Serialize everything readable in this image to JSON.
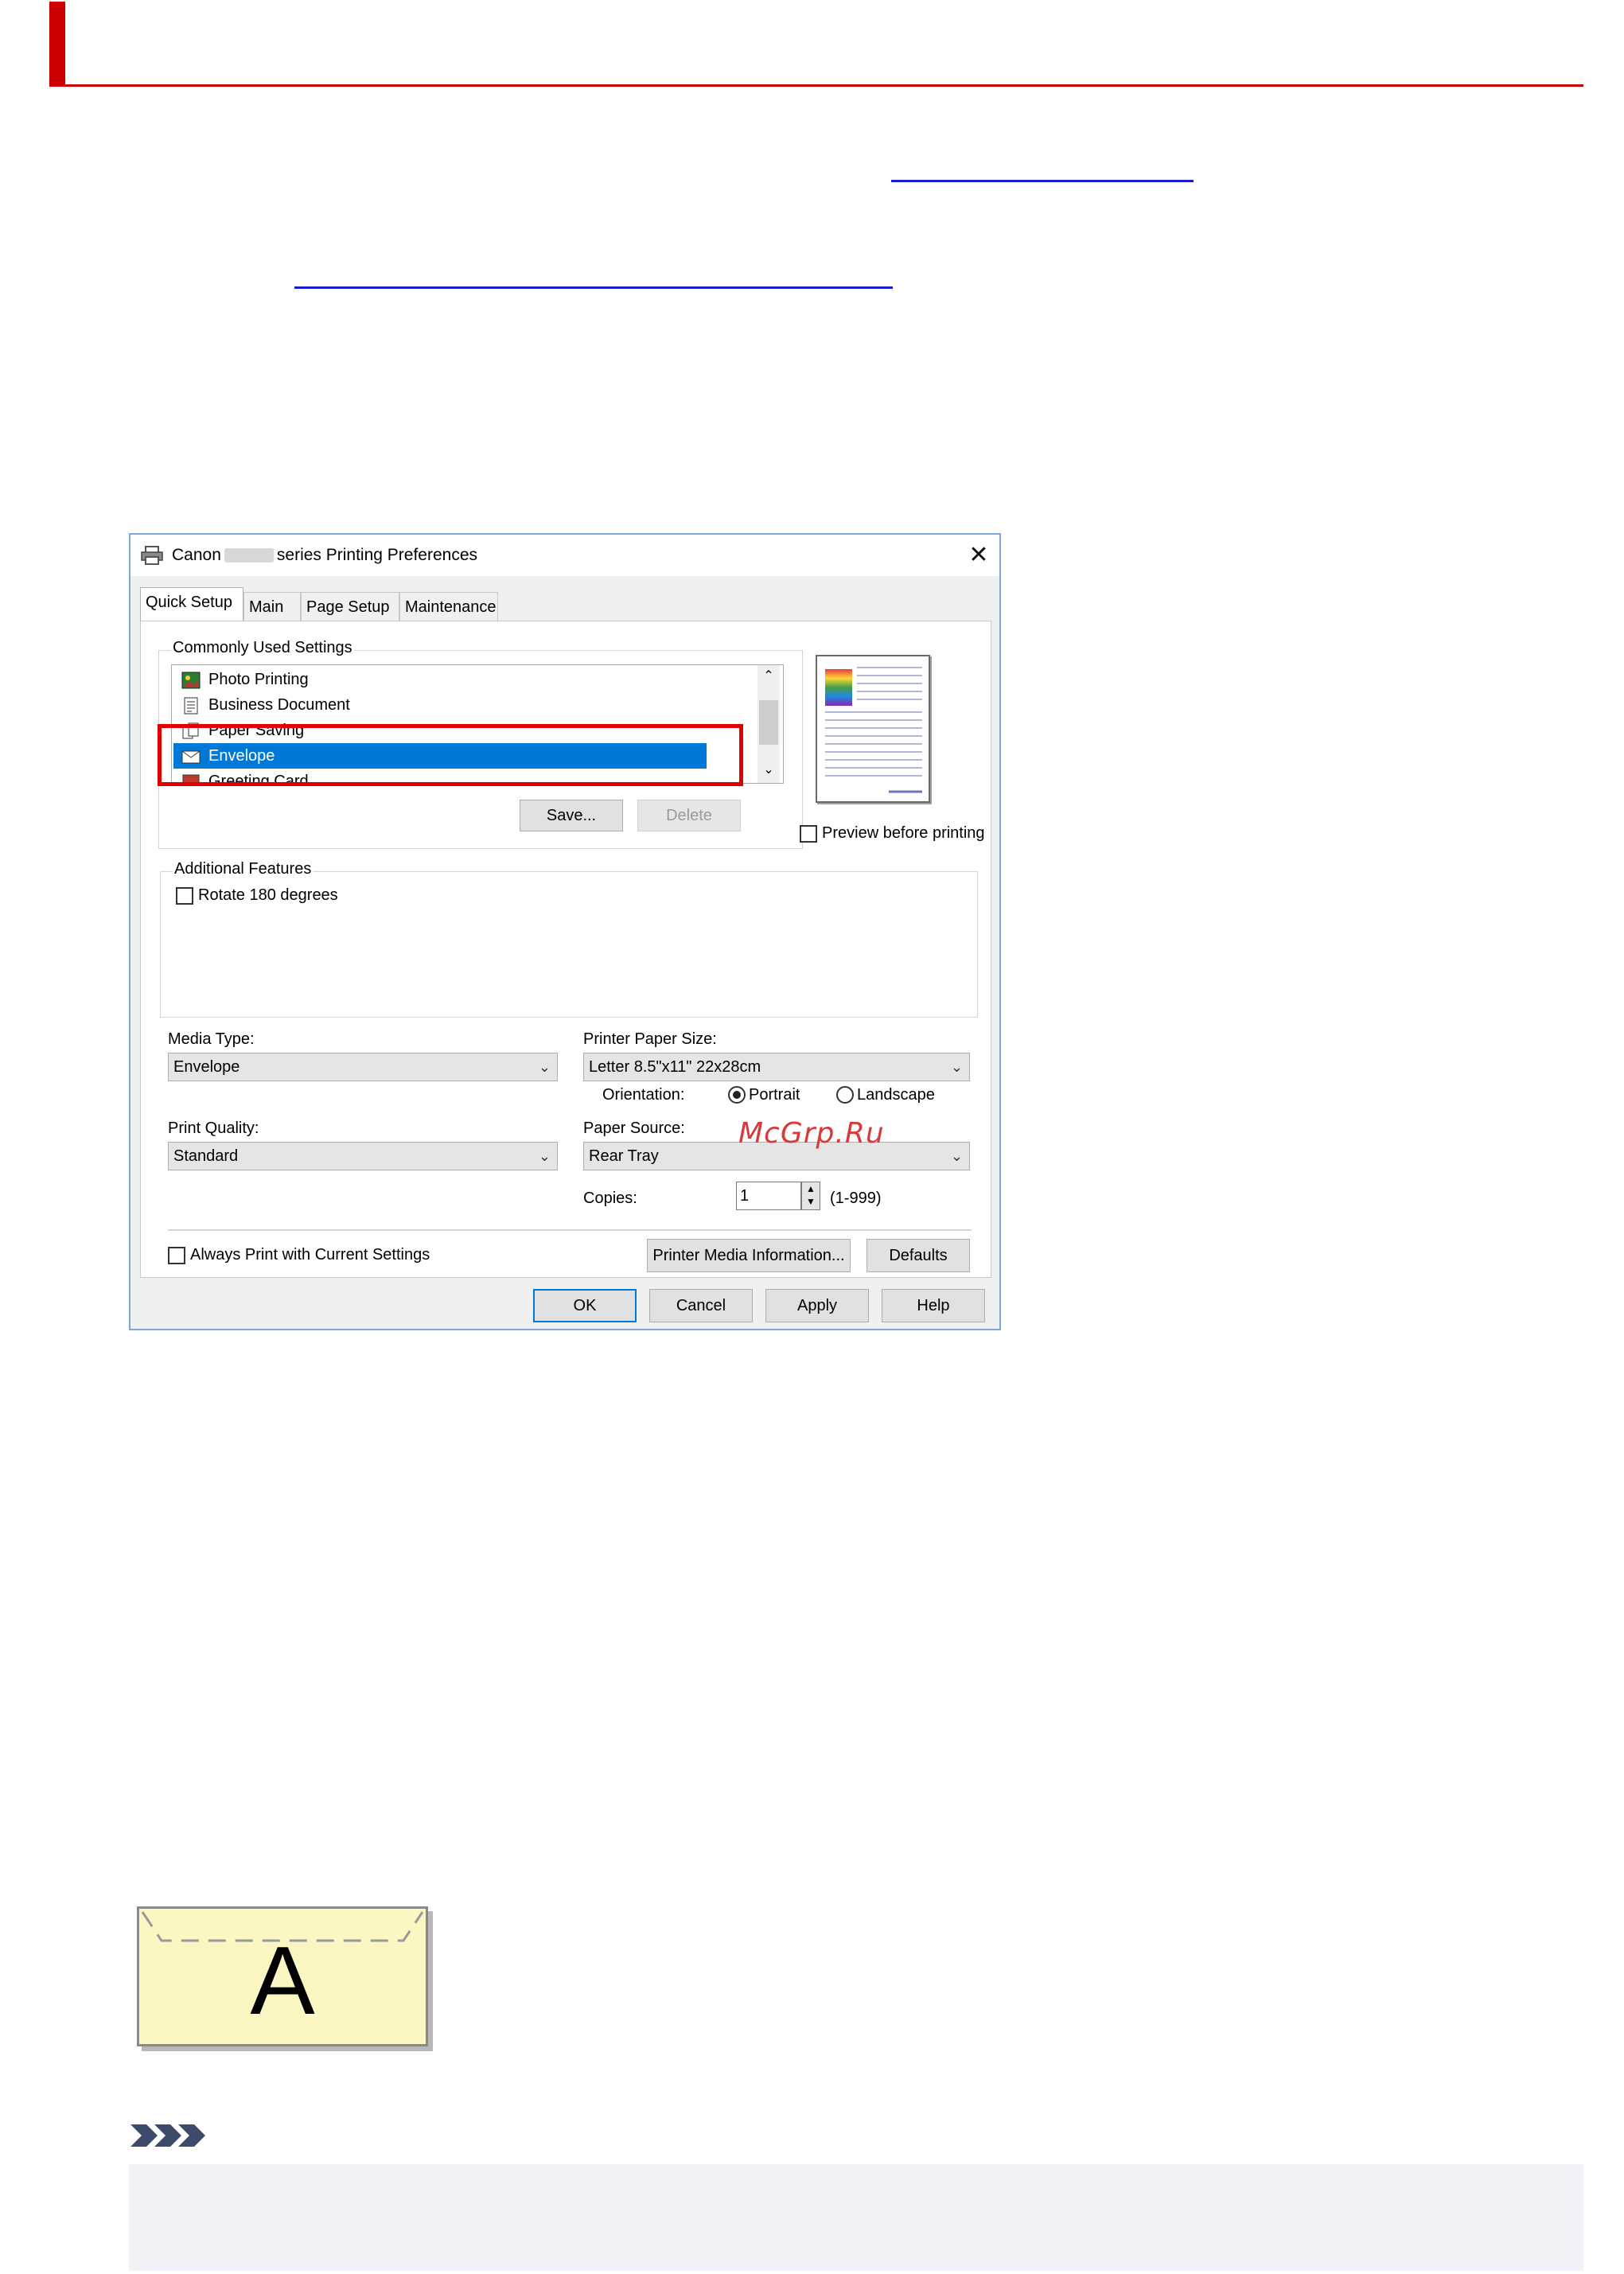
{
  "dialog": {
    "title_prefix": "Canon",
    "title_suffix": "series Printing Preferences",
    "close_glyph": "✕",
    "tabs": [
      {
        "label": "Quick Setup",
        "active": true
      },
      {
        "label": "Main",
        "active": false
      },
      {
        "label": "Page Setup",
        "active": false
      },
      {
        "label": "Maintenance",
        "active": false
      }
    ],
    "commonly_used": {
      "label": "Commonly Used Settings",
      "items": [
        {
          "label": "Photo Printing",
          "icon": "photo-icon"
        },
        {
          "label": "Business Document",
          "icon": "document-icon"
        },
        {
          "label": "Paper Saving",
          "icon": "paper-saving-icon"
        },
        {
          "label": "Envelope",
          "icon": "envelope-icon",
          "selected": true
        },
        {
          "label": "Greeting Card",
          "icon": "greeting-card-icon"
        }
      ],
      "save_label": "Save...",
      "delete_label": "Delete"
    },
    "preview_before_printing": {
      "label": "Preview before printing",
      "checked": false
    },
    "additional_features": {
      "label": "Additional Features",
      "rotate_180": {
        "label": "Rotate 180 degrees",
        "checked": false
      }
    },
    "media_type": {
      "label": "Media Type:",
      "value": "Envelope"
    },
    "print_quality": {
      "label": "Print Quality:",
      "value": "Standard"
    },
    "printer_paper_size": {
      "label": "Printer Paper Size:",
      "value": "Letter 8.5\"x11\" 22x28cm"
    },
    "orientation": {
      "label": "Orientation:",
      "portrait": "Portrait",
      "landscape": "Landscape",
      "selected": "Portrait"
    },
    "paper_source": {
      "label": "Paper Source:",
      "value": "Rear Tray"
    },
    "copies": {
      "label": "Copies:",
      "value": "1",
      "range": "(1-999)"
    },
    "always_print": {
      "label": "Always Print with Current Settings",
      "checked": false
    },
    "printer_media_info_label": "Printer Media Information...",
    "defaults_label": "Defaults",
    "ok_label": "OK",
    "cancel_label": "Cancel",
    "apply_label": "Apply",
    "help_label": "Help"
  },
  "watermark": "McGrp.Ru",
  "illustration": {
    "letter": "A"
  },
  "colors": {
    "accent": "#cc0000",
    "link": "#1a1ad0",
    "selection": "#0078d7",
    "highlight_box": "#e00000"
  }
}
